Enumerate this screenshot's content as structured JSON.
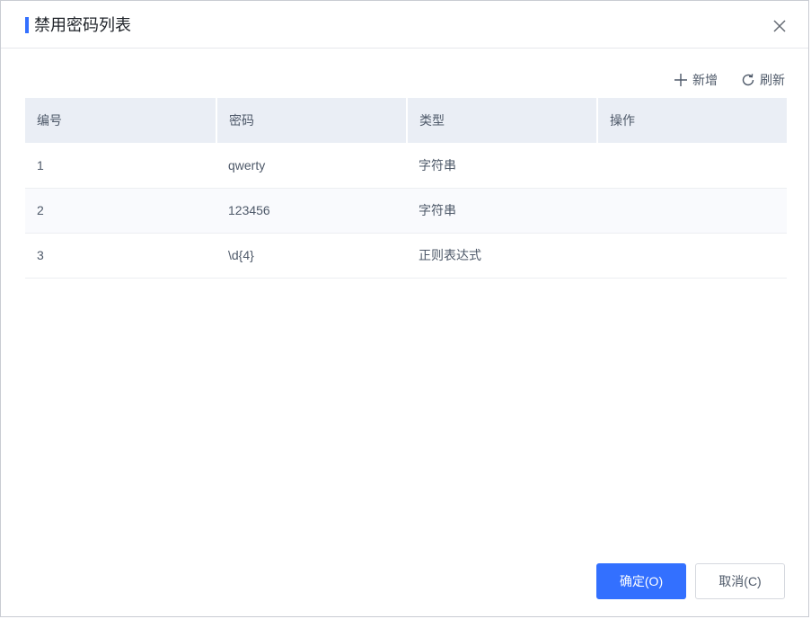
{
  "dialog": {
    "title": "禁用密码列表",
    "accent_color": "#3370ff",
    "close_icon": "close-icon"
  },
  "toolbar": {
    "add_label": "新增",
    "add_icon": "plus-icon",
    "refresh_label": "刷新",
    "refresh_icon": "refresh-icon"
  },
  "table": {
    "columns": [
      "编号",
      "密码",
      "类型",
      "操作"
    ],
    "rows": [
      {
        "id": "1",
        "password": "qwerty",
        "type": "字符串",
        "action": ""
      },
      {
        "id": "2",
        "password": "123456",
        "type": "字符串",
        "action": ""
      },
      {
        "id": "3",
        "password": "\\d{4}",
        "type": "正则表达式",
        "action": ""
      }
    ]
  },
  "footer": {
    "ok_label": "确定(O)",
    "cancel_label": "取消(C)"
  }
}
